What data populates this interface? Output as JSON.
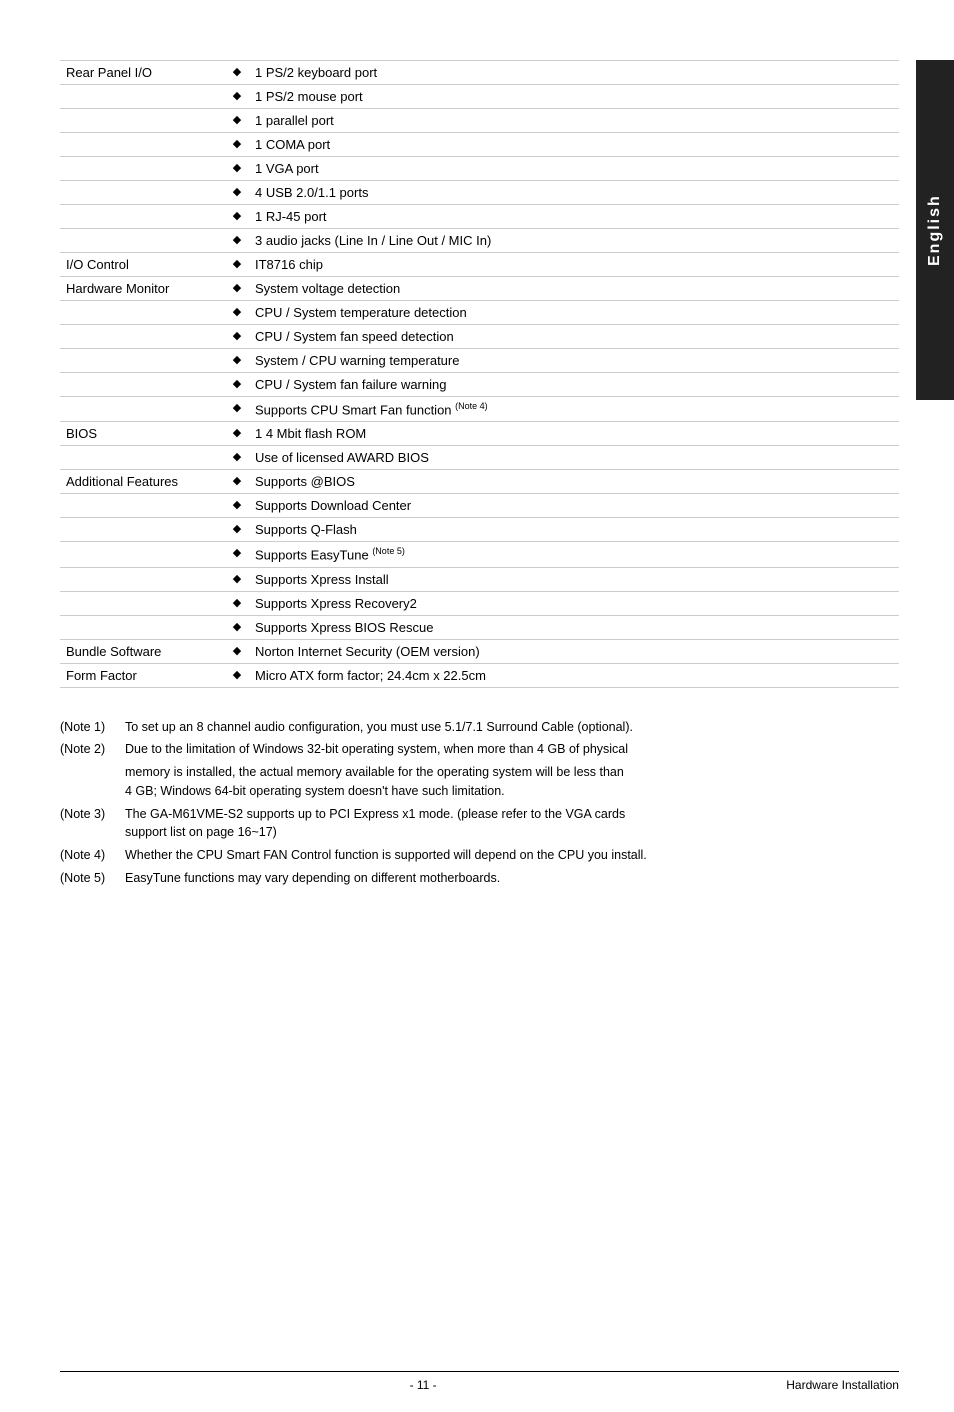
{
  "english_tab": "English",
  "specs": [
    {
      "label": "Rear Panel I/O",
      "items": [
        "1 PS/2 keyboard port",
        "1 PS/2 mouse port",
        "1 parallel port",
        "1 COMA port",
        "1 VGA port",
        "4 USB 2.0/1.1 ports",
        "1 RJ-45 port",
        "3 audio jacks (Line In / Line Out / MIC In)"
      ]
    },
    {
      "label": "I/O Control",
      "items": [
        "IT8716 chip"
      ]
    },
    {
      "label": "Hardware Monitor",
      "items": [
        "System voltage detection",
        "CPU / System temperature detection",
        "CPU / System fan speed detection",
        "System / CPU warning temperature",
        "CPU / System fan failure warning",
        "Supports CPU Smart Fan function"
      ],
      "superscripts": [
        null,
        null,
        null,
        null,
        null,
        "Note 4"
      ]
    },
    {
      "label": "BIOS",
      "items": [
        "1 4 Mbit flash ROM",
        "Use of licensed AWARD BIOS"
      ]
    },
    {
      "label": "Additional Features",
      "items": [
        "Supports @BIOS",
        "Supports Download Center",
        "Supports Q-Flash",
        "Supports EasyTune",
        "Supports Xpress Install",
        "Supports Xpress Recovery2",
        "Supports Xpress BIOS Rescue"
      ],
      "superscripts": [
        null,
        null,
        null,
        "Note 5",
        null,
        null,
        null
      ]
    },
    {
      "label": "Bundle Software",
      "items": [
        "Norton Internet Security (OEM version)"
      ]
    },
    {
      "label": "Form Factor",
      "items": [
        "Micro ATX form factor; 24.4cm x 22.5cm"
      ]
    }
  ],
  "notes": [
    {
      "label": "(Note 1)",
      "text": "To set up an 8 channel audio configuration, you must use 5.1/7.1 Surround Cable (optional)."
    },
    {
      "label": "(Note 2)",
      "text": "Due to the limitation of Windows 32-bit operating system, when more than 4 GB of physical",
      "continuation": "memory is installed, the actual memory available for the operating system will be less than\n4 GB; Windows 64-bit operating system doesn't have such limitation."
    },
    {
      "label": "(Note 3)",
      "text": "The GA-M61VME-S2 supports up to PCI Express x1 mode. (please refer to the VGA cards\nsupport list on page 16~17)"
    },
    {
      "label": "(Note 4)",
      "text": "Whether the CPU Smart FAN Control function is supported will depend on the CPU you install."
    },
    {
      "label": "(Note 5)",
      "text": "EasyTune functions may vary depending on different motherboards."
    }
  ],
  "footer": {
    "left": "",
    "center": "- 11 -",
    "right": "Hardware Installation"
  }
}
